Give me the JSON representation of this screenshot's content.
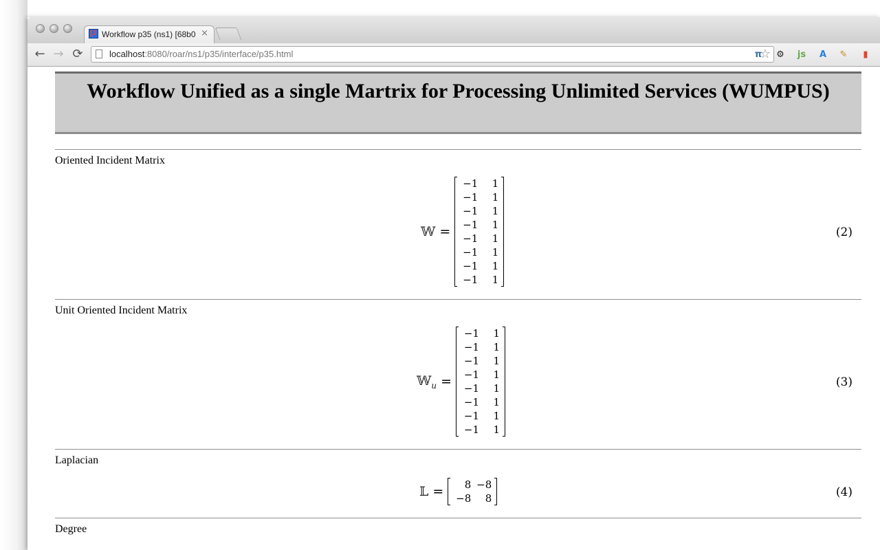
{
  "browser": {
    "tab_title": "Workflow p35 (ns1) [68b0",
    "tab_fade": "",
    "tab_close": "×",
    "favicon_glyph": "[J",
    "url_host": "localhost",
    "url_path": ":8080/roar/ns1/p35/interface/p35.html",
    "back_icon": "←",
    "forward_icon": "→",
    "reload_icon": "⟳",
    "star_icon": "☆",
    "extensions": [
      {
        "name": "pi-extension-icon",
        "glyph": "π",
        "color": "#3b6ea8"
      },
      {
        "name": "settings-extension-icon",
        "glyph": "⚙",
        "color": "#222222"
      },
      {
        "name": "js-extension-icon",
        "glyph": "js",
        "color": "#6aa84f"
      },
      {
        "name": "translate-extension-icon",
        "glyph": "A",
        "color": "#2a7fd4"
      },
      {
        "name": "colorpicker-extension-icon",
        "glyph": "✎",
        "color": "#c98a2a"
      },
      {
        "name": "bookmark-extension-icon",
        "glyph": "▮",
        "color": "#e0452a"
      }
    ]
  },
  "page": {
    "title": "Workflow Unified as a single Martrix for Processing Unlimited Services (WUMPUS)",
    "sections": [
      {
        "label": "Oriented Incident Matrix",
        "symbol": "𝕎",
        "subscript": "",
        "number": "(2)",
        "rows": [
          [
            "−1",
            "1"
          ],
          [
            "−1",
            "1"
          ],
          [
            "−1",
            "1"
          ],
          [
            "−1",
            "1"
          ],
          [
            "−1",
            "1"
          ],
          [
            "−1",
            "1"
          ],
          [
            "−1",
            "1"
          ],
          [
            "−1",
            "1"
          ]
        ]
      },
      {
        "label": "Unit Oriented Incident Matrix",
        "symbol": "𝕎",
        "subscript": "u",
        "number": "(3)",
        "rows": [
          [
            "−1",
            "1"
          ],
          [
            "−1",
            "1"
          ],
          [
            "−1",
            "1"
          ],
          [
            "−1",
            "1"
          ],
          [
            "−1",
            "1"
          ],
          [
            "−1",
            "1"
          ],
          [
            "−1",
            "1"
          ],
          [
            "−1",
            "1"
          ]
        ]
      },
      {
        "label": "Laplacian",
        "symbol": "𝕃",
        "subscript": "",
        "number": "(4)",
        "rows": [
          [
            "8",
            "−8"
          ],
          [
            "−8",
            "8"
          ]
        ]
      },
      {
        "label": "Degree",
        "symbol": "",
        "subscript": "",
        "number": "",
        "rows": []
      }
    ]
  }
}
